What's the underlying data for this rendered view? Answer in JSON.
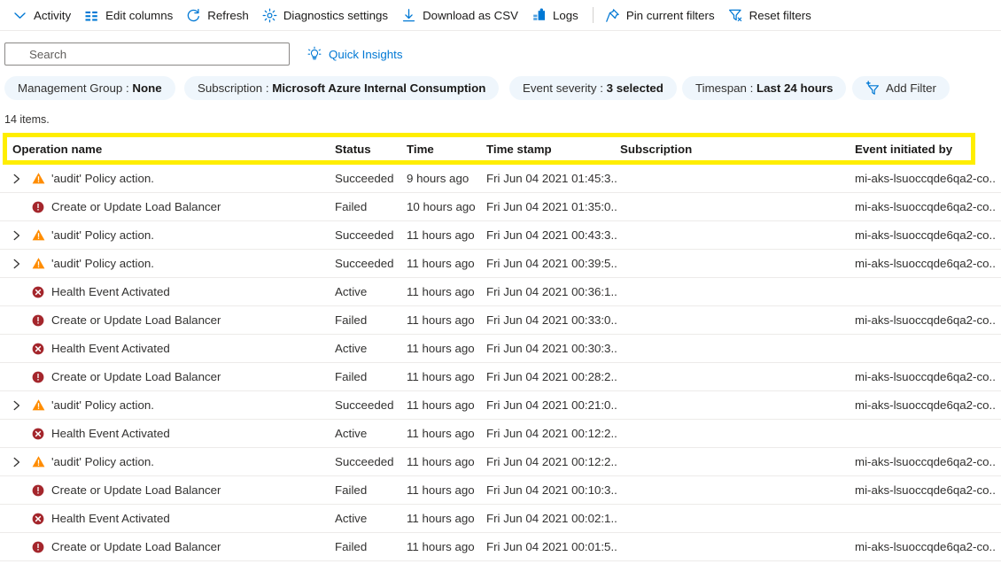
{
  "commandbar": {
    "items": [
      {
        "label": "Activity",
        "icon": "chevron-down-icon"
      },
      {
        "label": "Edit columns",
        "icon": "edit-columns-icon"
      },
      {
        "label": "Refresh",
        "icon": "refresh-icon"
      },
      {
        "label": "Diagnostics settings",
        "icon": "gear-icon"
      },
      {
        "label": "Download as CSV",
        "icon": "download-icon"
      },
      {
        "label": "Logs",
        "icon": "logs-icon"
      },
      {
        "label": "Pin current filters",
        "icon": "pin-icon"
      },
      {
        "label": "Reset filters",
        "icon": "reset-filter-icon"
      }
    ]
  },
  "search": {
    "placeholder": "Search",
    "value": "",
    "icon": "search-icon"
  },
  "quick_insights": {
    "label": "Quick Insights",
    "icon": "lightbulb-icon"
  },
  "filters": {
    "pills": [
      {
        "key": "Management Group",
        "value": "None"
      },
      {
        "key": "Subscription",
        "value": "Microsoft Azure Internal Consumption"
      },
      {
        "key": "Event severity",
        "value": "3 selected"
      },
      {
        "key": "Timespan",
        "value": "Last 24 hours"
      }
    ],
    "add_filter_label": "Add Filter",
    "add_filter_icon": "add-filter-icon"
  },
  "results": {
    "count_label": "14 items.",
    "columns": [
      "Operation name",
      "Status",
      "Time",
      "Time stamp",
      "Subscription",
      "Event initiated by"
    ],
    "rows": [
      {
        "expandable": true,
        "severity": "warning",
        "operation": "'audit' Policy action.",
        "status": "Succeeded",
        "time": "9 hours ago",
        "timestamp": "Fri Jun 04 2021 01:45:3...",
        "subscription": "",
        "initiated_by": "mi-aks-lsuoccqde6qa2-co..."
      },
      {
        "expandable": false,
        "severity": "error",
        "operation": "Create or Update Load Balancer",
        "status": "Failed",
        "time": "10 hours ago",
        "timestamp": "Fri Jun 04 2021 01:35:0...",
        "subscription": "",
        "initiated_by": "mi-aks-lsuoccqde6qa2-co..."
      },
      {
        "expandable": true,
        "severity": "warning",
        "operation": "'audit' Policy action.",
        "status": "Succeeded",
        "time": "11 hours ago",
        "timestamp": "Fri Jun 04 2021 00:43:3...",
        "subscription": "",
        "initiated_by": "mi-aks-lsuoccqde6qa2-co..."
      },
      {
        "expandable": true,
        "severity": "warning",
        "operation": "'audit' Policy action.",
        "status": "Succeeded",
        "time": "11 hours ago",
        "timestamp": "Fri Jun 04 2021 00:39:5...",
        "subscription": "",
        "initiated_by": "mi-aks-lsuoccqde6qa2-co..."
      },
      {
        "expandable": false,
        "severity": "critical",
        "operation": "Health Event Activated",
        "status": "Active",
        "time": "11 hours ago",
        "timestamp": "Fri Jun 04 2021 00:36:1...",
        "subscription": "",
        "initiated_by": ""
      },
      {
        "expandable": false,
        "severity": "error",
        "operation": "Create or Update Load Balancer",
        "status": "Failed",
        "time": "11 hours ago",
        "timestamp": "Fri Jun 04 2021 00:33:0...",
        "subscription": "",
        "initiated_by": "mi-aks-lsuoccqde6qa2-co..."
      },
      {
        "expandable": false,
        "severity": "critical",
        "operation": "Health Event Activated",
        "status": "Active",
        "time": "11 hours ago",
        "timestamp": "Fri Jun 04 2021 00:30:3...",
        "subscription": "",
        "initiated_by": ""
      },
      {
        "expandable": false,
        "severity": "error",
        "operation": "Create or Update Load Balancer",
        "status": "Failed",
        "time": "11 hours ago",
        "timestamp": "Fri Jun 04 2021 00:28:2...",
        "subscription": "",
        "initiated_by": "mi-aks-lsuoccqde6qa2-co..."
      },
      {
        "expandable": true,
        "severity": "warning",
        "operation": "'audit' Policy action.",
        "status": "Succeeded",
        "time": "11 hours ago",
        "timestamp": "Fri Jun 04 2021 00:21:0...",
        "subscription": "",
        "initiated_by": "mi-aks-lsuoccqde6qa2-co..."
      },
      {
        "expandable": false,
        "severity": "critical",
        "operation": "Health Event Activated",
        "status": "Active",
        "time": "11 hours ago",
        "timestamp": "Fri Jun 04 2021 00:12:2...",
        "subscription": "",
        "initiated_by": ""
      },
      {
        "expandable": true,
        "severity": "warning",
        "operation": "'audit' Policy action.",
        "status": "Succeeded",
        "time": "11 hours ago",
        "timestamp": "Fri Jun 04 2021 00:12:2...",
        "subscription": "",
        "initiated_by": "mi-aks-lsuoccqde6qa2-co..."
      },
      {
        "expandable": false,
        "severity": "error",
        "operation": "Create or Update Load Balancer",
        "status": "Failed",
        "time": "11 hours ago",
        "timestamp": "Fri Jun 04 2021 00:10:3...",
        "subscription": "",
        "initiated_by": "mi-aks-lsuoccqde6qa2-co..."
      },
      {
        "expandable": false,
        "severity": "critical",
        "operation": "Health Event Activated",
        "status": "Active",
        "time": "11 hours ago",
        "timestamp": "Fri Jun 04 2021 00:02:1...",
        "subscription": "",
        "initiated_by": ""
      },
      {
        "expandable": false,
        "severity": "error",
        "operation": "Create or Update Load Balancer",
        "status": "Failed",
        "time": "11 hours ago",
        "timestamp": "Fri Jun 04 2021 00:01:5...",
        "subscription": "",
        "initiated_by": "mi-aks-lsuoccqde6qa2-co..."
      }
    ]
  },
  "colors": {
    "accent": "#0078d4",
    "pill_bg": "#eff6fc",
    "highlight": "#ffee00",
    "severity_warning": "#ff8c00",
    "severity_error": "#a4262c",
    "severity_critical": "#a4262c",
    "row_border": "#edebe9"
  }
}
